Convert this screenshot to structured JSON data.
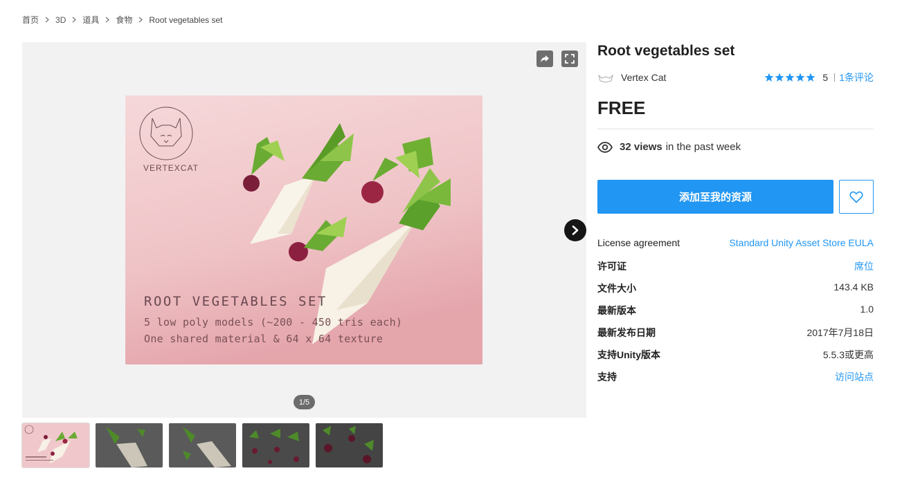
{
  "breadcrumb": [
    "首页",
    "3D",
    "道具",
    "食物",
    "Root vegetables set"
  ],
  "viewer": {
    "counter": "1/5",
    "image_text": {
      "brand": "VERTEXCAT",
      "title": "ROOT VEGETABLES SET",
      "line1": "5 low poly models (~200 - 450 tris each)",
      "line2": "One shared material & 64 x 64 texture"
    },
    "icons": {
      "share": "share-icon",
      "fullscreen": "fullscreen-icon",
      "next": "chevron-right-icon"
    }
  },
  "thumbnails": [
    {
      "label": "thumbnail-1",
      "active": true
    },
    {
      "label": "thumbnail-2",
      "active": false
    },
    {
      "label": "thumbnail-3",
      "active": false
    },
    {
      "label": "thumbnail-4",
      "active": false
    },
    {
      "label": "thumbnail-5",
      "active": false
    }
  ],
  "product": {
    "title": "Root vegetables set",
    "publisher": "Vertex Cat",
    "rating": {
      "stars": 5,
      "score": "5",
      "reviews": "1条评论"
    },
    "price": "FREE",
    "views": {
      "count": "32 views",
      "suffix": "in the past week"
    },
    "add_button": "添加至我的资源",
    "favorite_icon": "heart-icon"
  },
  "details": [
    {
      "label": "License agreement",
      "value": "Standard Unity Asset Store EULA",
      "link": true,
      "bold": false
    },
    {
      "label": "许可证",
      "value": "席位",
      "link": true,
      "bold": true
    },
    {
      "label": "文件大小",
      "value": "143.4 KB",
      "link": false,
      "bold": true
    },
    {
      "label": "最新版本",
      "value": "1.0",
      "link": false,
      "bold": true
    },
    {
      "label": "最新发布日期",
      "value": "2017年7月18日",
      "link": false,
      "bold": true
    },
    {
      "label": "支持Unity版本",
      "value": "5.5.3或更高",
      "link": false,
      "bold": true
    },
    {
      "label": "支持",
      "value": "访问站点",
      "link": true,
      "bold": true
    }
  ],
  "colors": {
    "accent": "#2196f3",
    "viewer_bg": "#f2f2f2",
    "image_pink": "#f0c4c8"
  }
}
